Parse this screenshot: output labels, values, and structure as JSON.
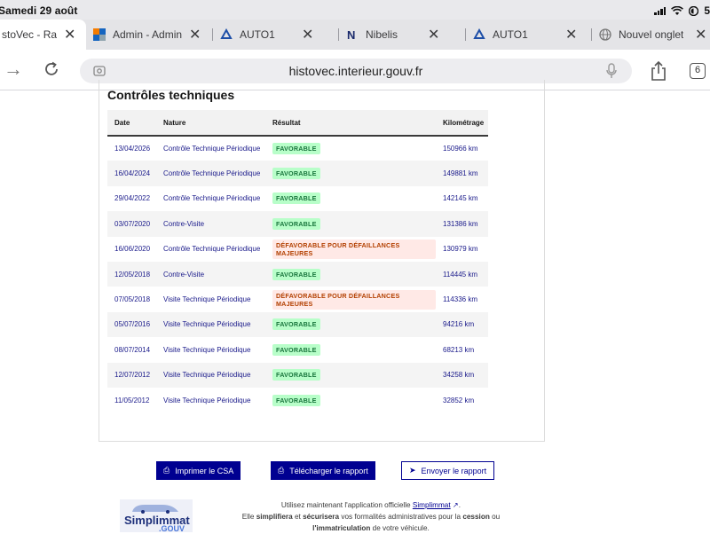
{
  "status_bar": {
    "time": "Samedi 29 août",
    "battery": "5"
  },
  "tabs": [
    {
      "title": "stoVec - Rap",
      "active": true
    },
    {
      "title": "Admin - Admin",
      "active": false
    },
    {
      "title": "AUTO1",
      "active": false
    },
    {
      "title": "Nibelis",
      "active": false
    },
    {
      "title": "AUTO1",
      "active": false
    },
    {
      "title": "Nouvel onglet",
      "active": false
    }
  ],
  "toolbar": {
    "url": "histovec.interieur.gouv.fr",
    "tab_count": "6"
  },
  "section": {
    "title": "Contrôles techniques"
  },
  "table": {
    "headers": [
      "Date",
      "Nature",
      "Résultat",
      "Kilométrage"
    ],
    "rows": [
      {
        "date": "13/04/2026",
        "nature": "Contrôle Technique Périodique",
        "result": "FAVORABLE",
        "status": "ok",
        "km": "150966 km"
      },
      {
        "date": "16/04/2024",
        "nature": "Contrôle Technique Périodique",
        "result": "FAVORABLE",
        "status": "ok",
        "km": "149881 km"
      },
      {
        "date": "29/04/2022",
        "nature": "Contrôle Technique Périodique",
        "result": "FAVORABLE",
        "status": "ok",
        "km": "142145 km"
      },
      {
        "date": "03/07/2020",
        "nature": "Contre-Visite",
        "result": "FAVORABLE",
        "status": "ok",
        "km": "131386 km"
      },
      {
        "date": "16/06/2020",
        "nature": "Contrôle Technique Périodique",
        "result": "DÉFAVORABLE POUR DÉFAILLANCES MAJEURES",
        "status": "ko",
        "km": "130979 km"
      },
      {
        "date": "12/05/2018",
        "nature": "Contre-Visite",
        "result": "FAVORABLE",
        "status": "ok",
        "km": "114445 km"
      },
      {
        "date": "07/05/2018",
        "nature": "Visite Technique Périodique",
        "result": "DÉFAVORABLE POUR DÉFAILLANCES MAJEURES",
        "status": "ko",
        "km": "114336 km"
      },
      {
        "date": "05/07/2016",
        "nature": "Visite Technique Périodique",
        "result": "FAVORABLE",
        "status": "ok",
        "km": "94216 km"
      },
      {
        "date": "08/07/2014",
        "nature": "Visite Technique Périodique",
        "result": "FAVORABLE",
        "status": "ok",
        "km": "68213 km"
      },
      {
        "date": "12/07/2012",
        "nature": "Visite Technique Périodique",
        "result": "FAVORABLE",
        "status": "ok",
        "km": "34258 km"
      },
      {
        "date": "11/05/2012",
        "nature": "Visite Technique Périodique",
        "result": "FAVORABLE",
        "status": "ok",
        "km": "32852 km"
      }
    ]
  },
  "actions": {
    "print": "Imprimer le CSA",
    "download": "Télécharger le rapport",
    "send": "Envoyer le rapport"
  },
  "promo": {
    "logo_line1": "Simplimmat",
    "logo_line2": ".GOUV",
    "intro": "Utilisez maintenant l'application officielle",
    "link": "Simplimmat",
    "line2_a": "Elle",
    "simplifiera": "simplifiera",
    "et": "et",
    "securisera": "sécurisera",
    "line2_b": "vos formalités administratives pour la",
    "cession": "cession",
    "ou": "ou",
    "immatriculation": "l'immatriculation",
    "line3_end": "de votre véhicule."
  },
  "colors": {
    "primary": "#000091",
    "ok_bg": "#b8fec9",
    "ok_text": "#18753c",
    "ko_bg": "#ffe9e6",
    "ko_text": "#b34000"
  }
}
